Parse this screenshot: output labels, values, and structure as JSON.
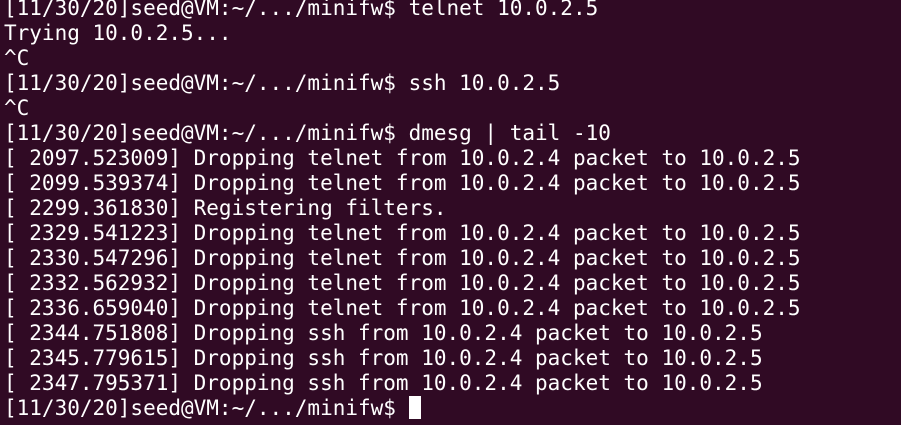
{
  "terminal": {
    "lines": [
      "[11/30/20]seed@VM:~/.../minifw$ telnet 10.0.2.5",
      "Trying 10.0.2.5...",
      "^C",
      "[11/30/20]seed@VM:~/.../minifw$ ssh 10.0.2.5",
      "^C",
      "[11/30/20]seed@VM:~/.../minifw$ dmesg | tail -10",
      "[ 2097.523009] Dropping telnet from 10.0.2.4 packet to 10.0.2.5",
      "[ 2099.539374] Dropping telnet from 10.0.2.4 packet to 10.0.2.5",
      "[ 2299.361830] Registering filters.",
      "[ 2329.541223] Dropping telnet from 10.0.2.4 packet to 10.0.2.5",
      "[ 2330.547296] Dropping telnet from 10.0.2.4 packet to 10.0.2.5",
      "[ 2332.562932] Dropping telnet from 10.0.2.4 packet to 10.0.2.5",
      "[ 2336.659040] Dropping telnet from 10.0.2.4 packet to 10.0.2.5",
      "[ 2344.751808] Dropping ssh from 10.0.2.4 packet to 10.0.2.5",
      "[ 2345.779615] Dropping ssh from 10.0.2.4 packet to 10.0.2.5",
      "[ 2347.795371] Dropping ssh from 10.0.2.4 packet to 10.0.2.5"
    ],
    "prompt": "[11/30/20]seed@VM:~/.../minifw$",
    "colors": {
      "background": "#300a24",
      "text": "#ffffff",
      "cursor": "#ffffff"
    }
  }
}
